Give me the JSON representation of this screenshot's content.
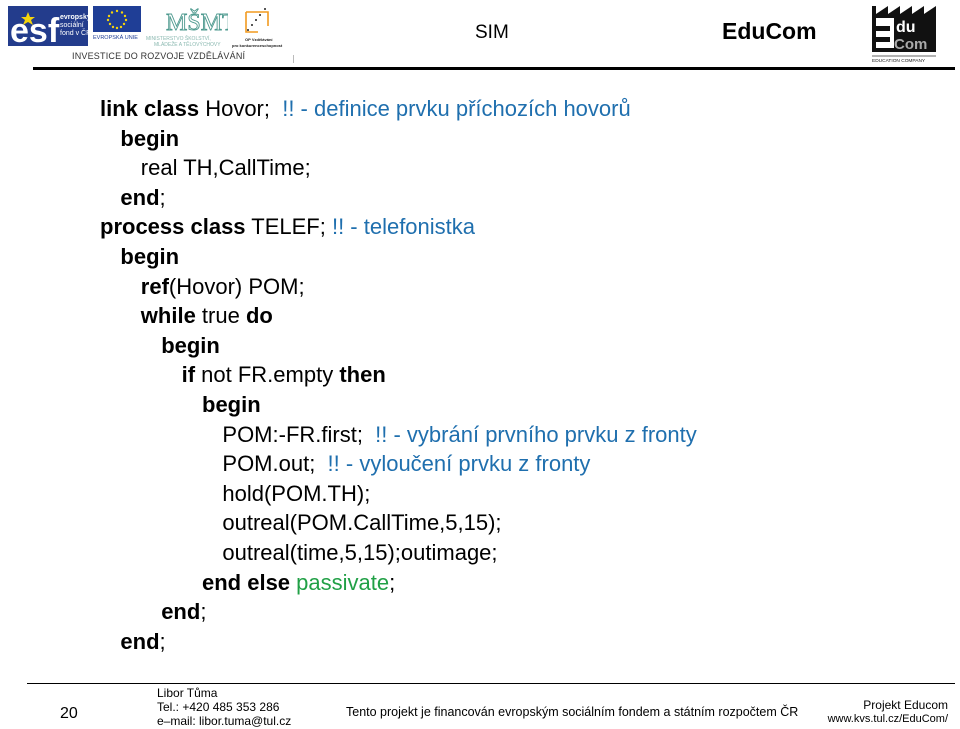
{
  "header": {
    "logos": {
      "esf": {
        "word": "esf",
        "lines": [
          "evropský",
          "sociální",
          "fond v ČR"
        ]
      },
      "eu": {
        "caption": "EVROPSKÁ UNIE"
      },
      "msmt": {
        "mark": "MŠMT",
        "lines": [
          "MINISTERSTVO ŠKOLSTVÍ,",
          "MLÁDEŽE A TĚLOVÝCHOVY"
        ]
      },
      "op": {
        "lines": [
          "OP Vzdělávání",
          "pro konkurenceschopnost"
        ]
      },
      "educom": {
        "top": "du",
        "bottom": "Com",
        "caption": "EDUCATION COMPANY"
      }
    },
    "investice": "INVESTICE DO ROZVOJE VZDĚLÁVÁNÍ",
    "subject": "SIM",
    "title": "EduCom",
    "colors": {
      "esf_blue": "#233c8c",
      "eu_blue": "#1f3e96",
      "eu_star": "#f5d40b",
      "msmt_teal": "#4e9a8f",
      "op_orange": "#f29a1f"
    }
  },
  "code": {
    "comment_color": "#1f6fae",
    "builtin_color": "#21a046",
    "lines": [
      [
        {
          "t": "link class",
          "s": "kw"
        },
        {
          "t": " Hovor;  "
        },
        {
          "t": "!! - definice prvku příchozích hovorů",
          "s": "cm"
        }
      ],
      [
        {
          "t": "  "
        },
        {
          "t": "begin",
          "s": "kw"
        }
      ],
      [
        {
          "t": "    real TH,CallTime;"
        }
      ],
      [
        {
          "t": "  "
        },
        {
          "t": "end",
          "s": "kw"
        },
        {
          "t": ";"
        }
      ],
      [
        {
          "t": "process class",
          "s": "kw"
        },
        {
          "t": " TELEF; "
        },
        {
          "t": "!! - telefonistka",
          "s": "cm"
        }
      ],
      [
        {
          "t": "  "
        },
        {
          "t": "begin",
          "s": "kw"
        }
      ],
      [
        {
          "t": "    "
        },
        {
          "t": "ref",
          "s": "kw"
        },
        {
          "t": "(Hovor) POM;"
        }
      ],
      [
        {
          "t": "    "
        },
        {
          "t": "while",
          "s": "kw"
        },
        {
          "t": " true "
        },
        {
          "t": "do",
          "s": "kw"
        }
      ],
      [
        {
          "t": "      "
        },
        {
          "t": "begin",
          "s": "kw"
        }
      ],
      [
        {
          "t": "        "
        },
        {
          "t": "if",
          "s": "kw"
        },
        {
          "t": " not FR.empty "
        },
        {
          "t": "then",
          "s": "kw"
        }
      ],
      [
        {
          "t": "          "
        },
        {
          "t": "begin",
          "s": "kw"
        }
      ],
      [
        {
          "t": "            POM:-FR.first;  "
        },
        {
          "t": "!! - vybrání prvního prvku z fronty",
          "s": "cm"
        }
      ],
      [
        {
          "t": "            POM.out;  "
        },
        {
          "t": "!! - vyloučení prvku z fronty",
          "s": "cm"
        }
      ],
      [
        {
          "t": "            hold(POM.TH);"
        }
      ],
      [
        {
          "t": "            outreal(POM.CallTime,5,15);"
        }
      ],
      [
        {
          "t": "            outreal(time,5,15);outimage;"
        }
      ],
      [
        {
          "t": "          "
        },
        {
          "t": "end else",
          "s": "kw"
        },
        {
          "t": " "
        },
        {
          "t": "passivate",
          "s": "gr"
        },
        {
          "t": ";"
        }
      ],
      [
        {
          "t": "      "
        },
        {
          "t": "end",
          "s": "kw"
        },
        {
          "t": ";"
        }
      ],
      [
        {
          "t": "  "
        },
        {
          "t": "end",
          "s": "kw"
        },
        {
          "t": ";"
        }
      ]
    ]
  },
  "footer": {
    "page_number": "20",
    "author": {
      "name": "Libor Tůma",
      "phone": "Tel.: +420 485 353 286",
      "email": "e–mail: libor.tuma@tul.cz"
    },
    "funding": "Tento projekt je financován evropským sociálním fondem a státním rozpočtem ČR",
    "project": {
      "name": "Projekt Educom",
      "url": "www.kvs.tul.cz/EduCom/"
    }
  }
}
